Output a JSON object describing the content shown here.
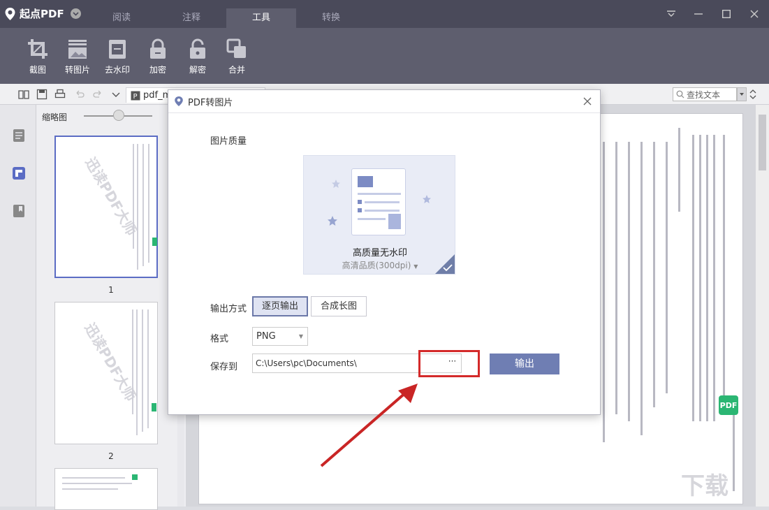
{
  "app": {
    "name": "起点PDF"
  },
  "tabs": [
    {
      "label": "阅读"
    },
    {
      "label": "注释"
    },
    {
      "label": "工具"
    },
    {
      "label": "转换"
    }
  ],
  "tools": [
    {
      "label": "截图",
      "icon": "crop-icon"
    },
    {
      "label": "转图片",
      "icon": "image-convert-icon"
    },
    {
      "label": "去水印",
      "icon": "remove-watermark-icon"
    },
    {
      "label": "加密",
      "icon": "lock-icon"
    },
    {
      "label": "解密",
      "icon": "unlock-icon"
    },
    {
      "label": "合并",
      "icon": "merge-icon"
    }
  ],
  "document": {
    "tab_label": "pdf_me"
  },
  "search": {
    "placeholder": "查找文本"
  },
  "thumbnails": {
    "header": "缩略图",
    "pages": [
      {
        "num": "1"
      },
      {
        "num": "2"
      }
    ],
    "watermark": "迅读PDF大师"
  },
  "dialog": {
    "title": "PDF转图片",
    "quality_label": "图片质量",
    "quality_card": {
      "title": "高质量无水印",
      "subtitle": "高清品质(300dpi)"
    },
    "output_mode_label": "输出方式",
    "output_modes": [
      {
        "label": "逐页输出"
      },
      {
        "label": "合成长图"
      }
    ],
    "format_label": "格式",
    "format_value": "PNG",
    "save_label": "保存到",
    "save_path": "C:\\Users\\pc\\Documents\\",
    "browse_label": "···",
    "output_button": "输出"
  },
  "colors": {
    "accent": "#6f7eb3",
    "highlight": "#d42a2a",
    "titlebar": "#4a4a5a",
    "toolbar": "#5e5e6e"
  }
}
